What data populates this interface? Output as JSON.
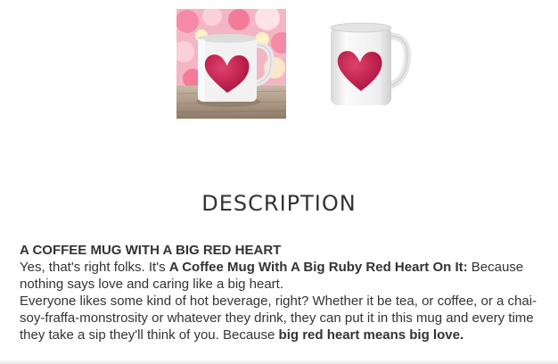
{
  "gallery": {
    "images": [
      {
        "alt": "mug with heart on flowers and wooden table"
      },
      {
        "alt": "mug with heart on white"
      }
    ]
  },
  "description": {
    "heading": "DESCRIPTION",
    "title": "A COFFEE MUG WITH A BIG RED HEART",
    "line1_intro": "Yes, that's right folks. It's ",
    "line1_bold": "A Coffee Mug With A Big Ruby Red Heart On It:",
    "line1_rest": " Because nothing says love and caring like a big heart.",
    "para2_text": "Everyone likes some kind of hot beverage, right? Whether it be tea, or coffee, or a chai-soy-fraffa-monstrosity or whatever they drink, they can put it in this mug and every time they take a sip they'll think of you. Because ",
    "para2_bold": "big red heart means big love."
  },
  "colors": {
    "heart": "#c8194b",
    "mug": "#f2f2f2"
  }
}
